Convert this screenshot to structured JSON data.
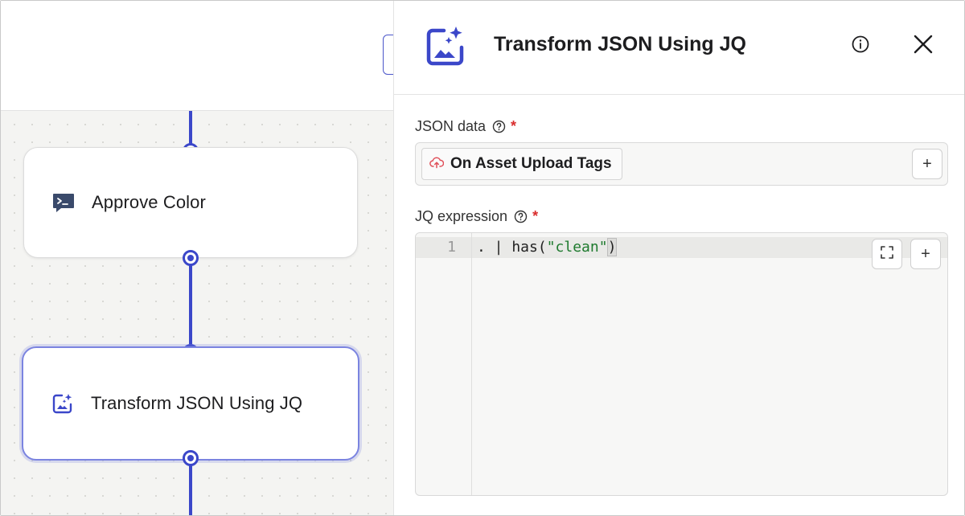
{
  "colors": {
    "accent": "#3b47c9",
    "selected_border": "#7b84e0",
    "required": "#d92d2d",
    "string_token": "#1e7a2e",
    "cloud_icon": "#e0505a"
  },
  "workflow": {
    "nodes": [
      {
        "label": "Approve Color",
        "icon": "terminal-chat-icon"
      },
      {
        "label": "Transform JSON Using JQ",
        "icon": "image-sparkle-icon",
        "selected": true
      }
    ]
  },
  "panel": {
    "title": "Transform JSON Using JQ",
    "icon": "image-sparkle-icon",
    "info_icon": "info-icon",
    "close_icon": "close-icon",
    "json_field": {
      "label": "JSON data",
      "required_mark": "*",
      "tag": {
        "label": "On Asset Upload Tags",
        "icon": "cloud-upload-icon"
      },
      "add_label": "+"
    },
    "jq_field": {
      "label": "JQ expression",
      "required_mark": "*",
      "line_number": "1",
      "code_prefix": ". | has(",
      "code_string": "\"clean\"",
      "code_suffix": ")",
      "add_label": "+",
      "expand_icon": "expand-icon"
    }
  }
}
